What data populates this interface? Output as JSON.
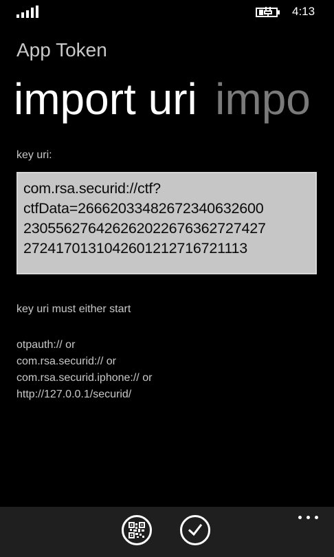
{
  "status": {
    "time": "4:13",
    "signal_icon": "signal-bars-icon",
    "battery_icon": "battery-charging-icon"
  },
  "header": {
    "app_title": "App Token",
    "pivot_items": [
      {
        "label": "import uri",
        "active": true
      },
      {
        "label": "impo",
        "active": false
      }
    ]
  },
  "form": {
    "key_uri_label": "key uri:",
    "key_uri_lines": [
      "com.rsa.securid://ctf?",
      "ctfData=2666203348267234063260​0",
      "2305562764262620226763627274​27",
      "272417013104260121271672111​3"
    ]
  },
  "hint": {
    "intro": "key uri must either start",
    "options": [
      "otpauth:// or",
      "com.rsa.securid:// or",
      "com.rsa.securid.iphone:// or",
      "http://127.0.0.1/securid/"
    ]
  },
  "app_bar": {
    "buttons": [
      {
        "name": "scan-qr",
        "icon": "qr-code-icon"
      },
      {
        "name": "accept",
        "icon": "check-icon"
      }
    ],
    "more_icon": "more-dots-icon"
  },
  "colors": {
    "background": "#000000",
    "text": "#ffffff",
    "secondary_text": "#c9c9c9",
    "inactive_pivot": "#7a7a7a",
    "input_background": "#c6c6c6",
    "app_bar": "#1f1f1f"
  }
}
